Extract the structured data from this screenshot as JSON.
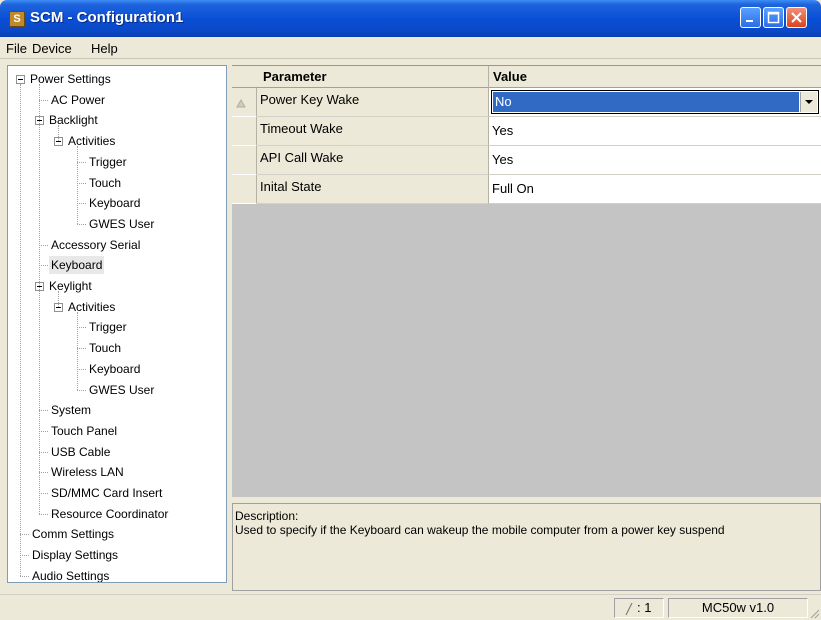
{
  "window": {
    "title": "SCM - Configuration1",
    "app_icon": "scm-app-icon"
  },
  "menu": {
    "items": [
      "File",
      "Device",
      "Help"
    ]
  },
  "tree": {
    "items": [
      {
        "label": "Power Settings",
        "level": 0,
        "expandable": true
      },
      {
        "label": "AC Power",
        "level": 1
      },
      {
        "label": "Backlight",
        "level": 1,
        "expandable": true
      },
      {
        "label": "Activities",
        "level": 2,
        "expandable": true
      },
      {
        "label": "Trigger",
        "level": 3
      },
      {
        "label": "Touch",
        "level": 3
      },
      {
        "label": "Keyboard",
        "level": 3
      },
      {
        "label": "GWES User",
        "level": 3
      },
      {
        "label": "Accessory Serial",
        "level": 1
      },
      {
        "label": "Keyboard",
        "level": 1,
        "selected": true
      },
      {
        "label": "Keylight",
        "level": 1,
        "expandable": true
      },
      {
        "label": "Activities",
        "level": 2,
        "expandable": true
      },
      {
        "label": "Trigger",
        "level": 3
      },
      {
        "label": "Touch",
        "level": 3
      },
      {
        "label": "Keyboard",
        "level": 3
      },
      {
        "label": "GWES User",
        "level": 3
      },
      {
        "label": "System",
        "level": 1
      },
      {
        "label": "Touch Panel",
        "level": 1
      },
      {
        "label": "USB Cable",
        "level": 1
      },
      {
        "label": "Wireless LAN",
        "level": 1
      },
      {
        "label": "SD/MMC Card Insert",
        "level": 1
      },
      {
        "label": "Resource Coordinator",
        "level": 1
      },
      {
        "label": "Comm Settings",
        "level": 0
      },
      {
        "label": "Display Settings",
        "level": 0
      },
      {
        "label": "Audio Settings",
        "level": 0
      }
    ]
  },
  "grid": {
    "headers": {
      "parameter": "Parameter",
      "value": "Value"
    },
    "rows": [
      {
        "parameter": "Power Key Wake",
        "value": "No"
      },
      {
        "parameter": "Timeout Wake",
        "value": "Yes"
      },
      {
        "parameter": "API Call Wake",
        "value": "Yes"
      },
      {
        "parameter": "Inital State",
        "value": "Full On"
      }
    ]
  },
  "description": {
    "label": "Description:",
    "text": "Used to specify if the Keyboard can wakeup the mobile computer from a power key suspend"
  },
  "status": {
    "position": ": 1",
    "version": "MC50w v1.0"
  }
}
